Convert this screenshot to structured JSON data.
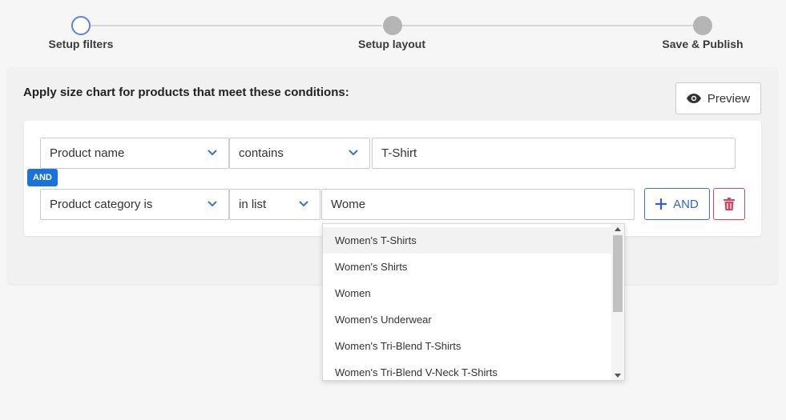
{
  "stepper": {
    "steps": [
      {
        "label": "Setup filters",
        "state": "active"
      },
      {
        "label": "Setup layout",
        "state": "inactive"
      },
      {
        "label": "Save & Publish",
        "state": "inactive"
      }
    ]
  },
  "card": {
    "title": "Apply size chart for products that meet these conditions:",
    "preview_label": "Preview",
    "preview_icon": "eye-icon"
  },
  "conditions": [
    {
      "field": "Product name",
      "operator": "contains",
      "value": "T-Shirt"
    },
    {
      "field": "Product category is",
      "operator": "in list",
      "value": "Wome"
    }
  ],
  "and_badge": "AND",
  "and_button_label": "AND",
  "dropdown": {
    "options": [
      "Women's T-Shirts",
      "Women's Shirts",
      "Women",
      "Women's Underwear",
      "Women's Tri-Blend T-Shirts",
      "Women's Tri-Blend V-Neck T-Shirts"
    ]
  },
  "colors": {
    "accent": "#1a73d9",
    "step_active": "#5e7fe5",
    "danger": "#d9435e"
  }
}
